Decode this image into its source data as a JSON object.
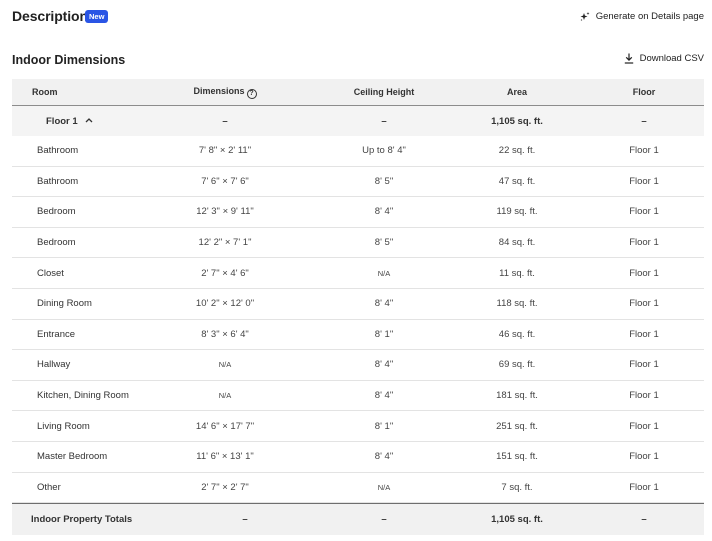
{
  "description": {
    "title": "Description",
    "badge": "New",
    "generate_label": "Generate on Details page"
  },
  "indoor": {
    "title": "Indoor Dimensions",
    "download_label": "Download CSV",
    "columns": {
      "room": "Room",
      "dimensions": "Dimensions",
      "ceiling": "Ceiling Height",
      "area": "Area",
      "floor": "Floor"
    },
    "floor_group": {
      "label": "Floor 1",
      "dimensions": "–",
      "ceiling": "–",
      "area": "1,105 sq. ft.",
      "floor": "–"
    },
    "rows": [
      {
        "room": "Bathroom",
        "dimensions": "7' 8\" × 2' 11\"",
        "ceiling": "Up to 8' 4\"",
        "area": "22 sq. ft.",
        "floor": "Floor 1"
      },
      {
        "room": "Bathroom",
        "dimensions": "7' 6\" × 7' 6\"",
        "ceiling": "8' 5\"",
        "area": "47 sq. ft.",
        "floor": "Floor 1"
      },
      {
        "room": "Bedroom",
        "dimensions": "12' 3\" × 9' 11\"",
        "ceiling": "8' 4\"",
        "area": "119 sq. ft.",
        "floor": "Floor 1"
      },
      {
        "room": "Bedroom",
        "dimensions": "12' 2\" × 7' 1\"",
        "ceiling": "8' 5\"",
        "area": "84 sq. ft.",
        "floor": "Floor 1"
      },
      {
        "room": "Closet",
        "dimensions": "2' 7\" × 4' 6\"",
        "ceiling": "N/A",
        "area": "11 sq. ft.",
        "floor": "Floor 1"
      },
      {
        "room": "Dining Room",
        "dimensions": "10' 2\" × 12' 0\"",
        "ceiling": "8' 4\"",
        "area": "118 sq. ft.",
        "floor": "Floor 1"
      },
      {
        "room": "Entrance",
        "dimensions": "8' 3\" × 6' 4\"",
        "ceiling": "8' 1\"",
        "area": "46 sq. ft.",
        "floor": "Floor 1"
      },
      {
        "room": "Hallway",
        "dimensions": "N/A",
        "ceiling": "8' 4\"",
        "area": "69 sq. ft.",
        "floor": "Floor 1"
      },
      {
        "room": "Kitchen, Dining Room",
        "dimensions": "N/A",
        "ceiling": "8' 4\"",
        "area": "181 sq. ft.",
        "floor": "Floor 1"
      },
      {
        "room": "Living Room",
        "dimensions": "14' 6\" × 17' 7\"",
        "ceiling": "8' 1\"",
        "area": "251 sq. ft.",
        "floor": "Floor 1"
      },
      {
        "room": "Master Bedroom",
        "dimensions": "11' 6\" × 13' 1\"",
        "ceiling": "8' 4\"",
        "area": "151 sq. ft.",
        "floor": "Floor 1"
      },
      {
        "room": "Other",
        "dimensions": "2' 7\" × 2' 7\"",
        "ceiling": "N/A",
        "area": "7 sq. ft.",
        "floor": "Floor 1"
      }
    ],
    "totals": {
      "label": "Indoor Property Totals",
      "dimensions": "–",
      "ceiling": "–",
      "area": "1,105 sq. ft.",
      "floor": "–"
    }
  }
}
